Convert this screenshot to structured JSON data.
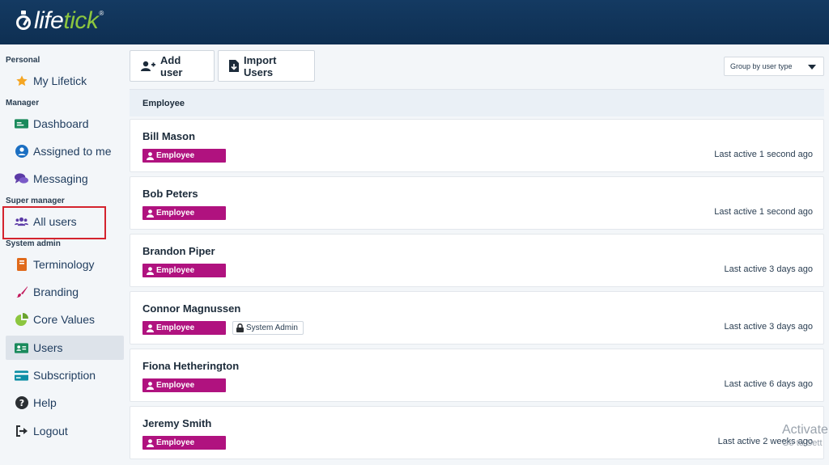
{
  "brand": {
    "logo_text_a": "life",
    "logo_text_b": "tick",
    "logo_reg": "®",
    "colors": {
      "header": "#0e2f52",
      "accent": "#8cc63f",
      "badge": "#b0127f",
      "highlight": "#d4232e"
    }
  },
  "sidebar": {
    "sections": [
      {
        "label": "Personal"
      },
      {
        "label": "Manager"
      },
      {
        "label": "Super manager"
      },
      {
        "label": "System admin"
      }
    ],
    "items": [
      {
        "label": "My Lifetick",
        "icon": "star-icon"
      },
      {
        "label": "Dashboard",
        "icon": "dashboard-icon"
      },
      {
        "label": "Assigned to me",
        "icon": "user-circle-icon"
      },
      {
        "label": "Messaging",
        "icon": "chat-icon"
      },
      {
        "label": "All users",
        "icon": "users-icon"
      },
      {
        "label": "Terminology",
        "icon": "book-icon"
      },
      {
        "label": "Branding",
        "icon": "brush-icon"
      },
      {
        "label": "Core Values",
        "icon": "pie-icon"
      },
      {
        "label": "Users",
        "icon": "id-card-icon",
        "active": true
      },
      {
        "label": "Subscription",
        "icon": "credit-card-icon"
      },
      {
        "label": "Help",
        "icon": "help-icon"
      },
      {
        "label": "Logout",
        "icon": "logout-icon"
      }
    ]
  },
  "toolbar": {
    "add_user_label": "Add user",
    "import_users_label": "Import Users",
    "group_by_label": "Group by user type"
  },
  "group": {
    "title": "Employee"
  },
  "users": [
    {
      "name": "Bill Mason",
      "role": "Employee",
      "extra": "",
      "last_active": "Last active 1 second ago"
    },
    {
      "name": "Bob Peters",
      "role": "Employee",
      "extra": "",
      "last_active": "Last active 1 second ago"
    },
    {
      "name": "Brandon Piper",
      "role": "Employee",
      "extra": "",
      "last_active": "Last active 3 days ago"
    },
    {
      "name": "Connor Magnussen",
      "role": "Employee",
      "extra": "System Admin",
      "last_active": "Last active 3 days ago"
    },
    {
      "name": "Fiona Hetherington",
      "role": "Employee",
      "extra": "",
      "last_active": "Last active 6 days ago"
    },
    {
      "name": "Jeremy Smith",
      "role": "Employee",
      "extra": "",
      "last_active": "Last active 2 weeks ago"
    }
  ],
  "watermark": {
    "line1": "Activate",
    "line2": "Go to Sett"
  }
}
